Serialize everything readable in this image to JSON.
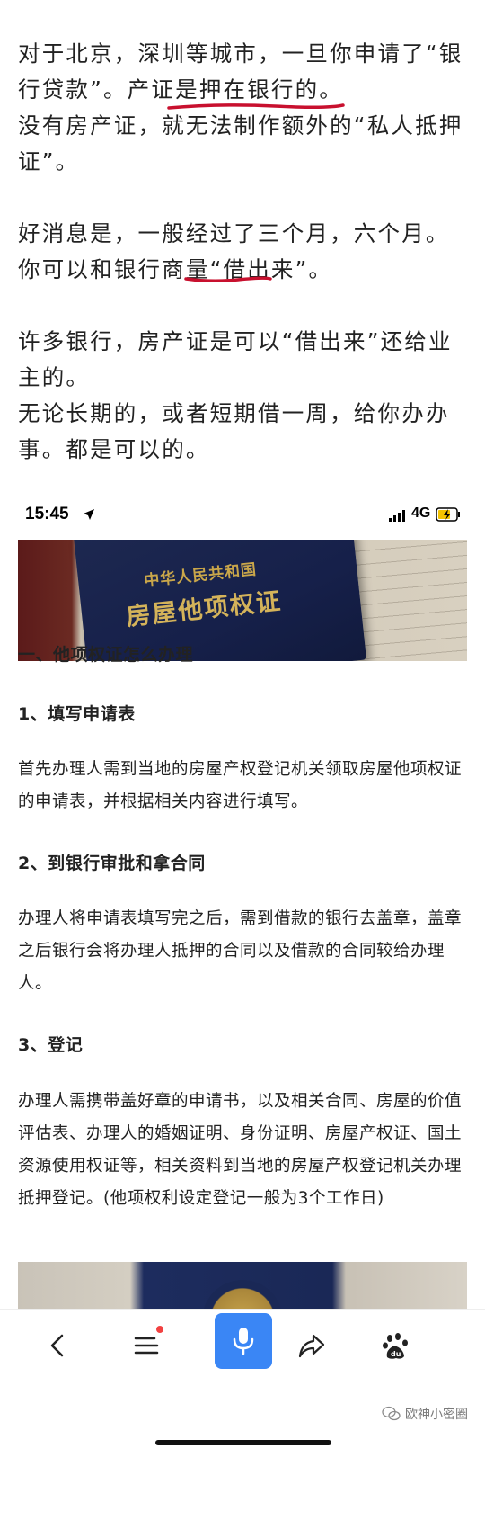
{
  "article": {
    "p1_part1": "对于北京，深圳等城市，一旦你申请了“银行贷款”。",
    "p1_highlight": "产证是押在银行的",
    "p1_end": "。",
    "p2": "没有房产证，就无法制作额外的“私人抵押证”。",
    "p3": "好消息是，一般经过了三个月，六个月。",
    "p4_part1": "你可以和银行商量",
    "p4_highlight": "“借出来”",
    "p4_end": "。",
    "p5": "许多银行，房产证是可以“借出来”还给业主的。",
    "p6": "无论长期的，或者短期借一周，给你办办事。都是可以的。"
  },
  "status_bar": {
    "time": "15:45",
    "network": "4G"
  },
  "hero_image": {
    "cover_line1": "中华人民共和国",
    "cover_line2": "房屋他项权证"
  },
  "content": {
    "heading_main": "一、他项权证怎么办理",
    "step1_title": "1、填写申请表",
    "step1_text": "首先办理人需到当地的房屋产权登记机关领取房屋他项权证的申请表，并根据相关内容进行填写。",
    "step2_title": "2、到银行审批和拿合同",
    "step2_text": "办理人将申请表填写完之后，需到借款的银行去盖章，盖章之后银行会将办理人抵押的合同以及借款的合同较给办理人。",
    "step3_title": "3、登记",
    "step3_text": "办理人需携带盖好章的申请书，以及相关合同、房屋的价值评估表、办理人的婚姻证明、身份证明、房屋产权证、国土资源使用权证等，相关资料到当地的房屋产权登记机关办理抵押登记。(他项权利设定登记一般为3个工作日)"
  },
  "navbar": {
    "watermark": "欧神小密圈"
  },
  "colors": {
    "accent_blue": "#3a86f5",
    "underline_red": "#c8102e",
    "badge_red": "#f24141"
  }
}
